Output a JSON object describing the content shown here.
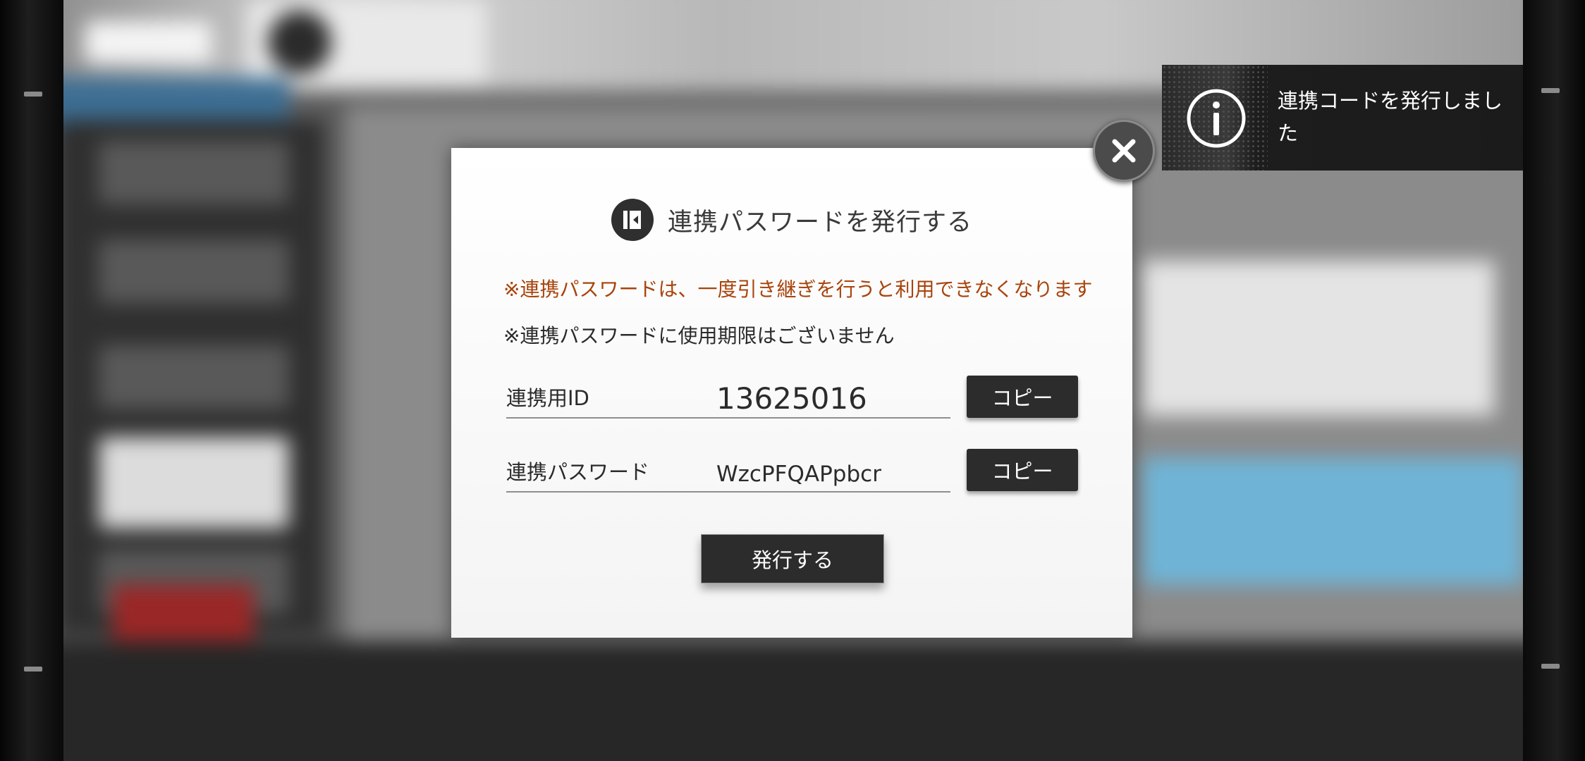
{
  "dialog": {
    "title": "連携パスワードを発行する",
    "warning": "※連携パスワードは、一度引き継ぎを行うと利用できなくなります",
    "note": "※連携パスワードに使用期限はございません",
    "id_label": "連携用ID",
    "id_value": "13625016",
    "password_label": "連携パスワード",
    "password_value": "WzcPFQAPpbcr",
    "copy_label": "コピー",
    "issue_label": "発行する"
  },
  "toast": {
    "message": "連携コードを発行しました",
    "icon": "info-icon"
  },
  "icons": {
    "title": "link-transfer-icon",
    "close": "close-icon"
  },
  "colors": {
    "warning": "#a8440c",
    "button": "#2c2c2c",
    "toast_bg": "#1b1b1b"
  }
}
